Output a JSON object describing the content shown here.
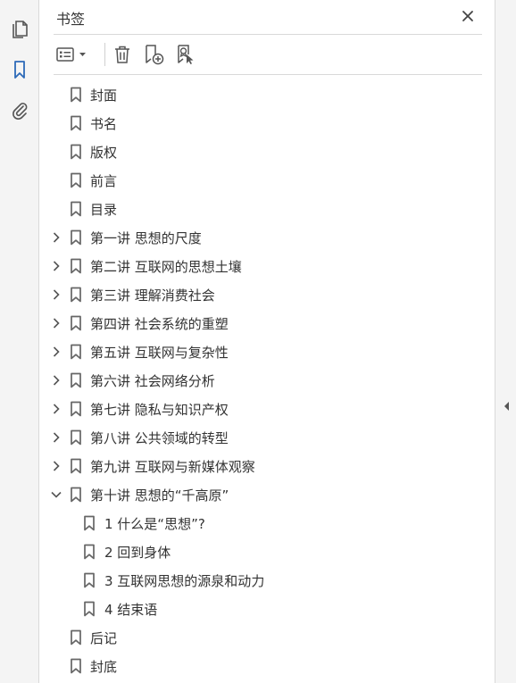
{
  "panel": {
    "title": "书签"
  },
  "icons": {
    "rail": [
      "pages-icon",
      "bookmark-icon",
      "attachment-icon"
    ],
    "toolbar": [
      "options-list-icon",
      "delete-icon",
      "new-bookmark-icon",
      "bookmark-from-selection-icon"
    ],
    "close": "close-icon",
    "collapse": "collapse-panel-icon"
  },
  "colors": {
    "accent": "#2d6ab8",
    "icon": "#555555",
    "text": "#333333",
    "rail_bg": "#f4f4f4"
  },
  "bookmarks": [
    {
      "label": "封面",
      "level": 0,
      "expandable": false
    },
    {
      "label": "书名",
      "level": 0,
      "expandable": false
    },
    {
      "label": "版权",
      "level": 0,
      "expandable": false
    },
    {
      "label": "前言",
      "level": 0,
      "expandable": false
    },
    {
      "label": "目录",
      "level": 0,
      "expandable": false
    },
    {
      "label": "第一讲  思想的尺度",
      "level": 0,
      "expandable": true,
      "expanded": false
    },
    {
      "label": "第二讲  互联网的思想土壤",
      "level": 0,
      "expandable": true,
      "expanded": false
    },
    {
      "label": "第三讲  理解消费社会",
      "level": 0,
      "expandable": true,
      "expanded": false
    },
    {
      "label": "第四讲  社会系统的重塑",
      "level": 0,
      "expandable": true,
      "expanded": false
    },
    {
      "label": "第五讲  互联网与复杂性",
      "level": 0,
      "expandable": true,
      "expanded": false
    },
    {
      "label": "第六讲  社会网络分析",
      "level": 0,
      "expandable": true,
      "expanded": false
    },
    {
      "label": "第七讲  隐私与知识产权",
      "level": 0,
      "expandable": true,
      "expanded": false
    },
    {
      "label": "第八讲  公共领域的转型",
      "level": 0,
      "expandable": true,
      "expanded": false
    },
    {
      "label": "第九讲  互联网与新媒体观察",
      "level": 0,
      "expandable": true,
      "expanded": false
    },
    {
      "label": "第十讲  思想的“千高原”",
      "level": 0,
      "expandable": true,
      "expanded": true
    },
    {
      "label": "1  什么是“思想”?",
      "level": 1,
      "expandable": false
    },
    {
      "label": "2  回到身体",
      "level": 1,
      "expandable": false
    },
    {
      "label": "3  互联网思想的源泉和动力",
      "level": 1,
      "expandable": false
    },
    {
      "label": "4  结束语",
      "level": 1,
      "expandable": false
    },
    {
      "label": "后记",
      "level": 0,
      "expandable": false
    },
    {
      "label": "封底",
      "level": 0,
      "expandable": false
    }
  ]
}
